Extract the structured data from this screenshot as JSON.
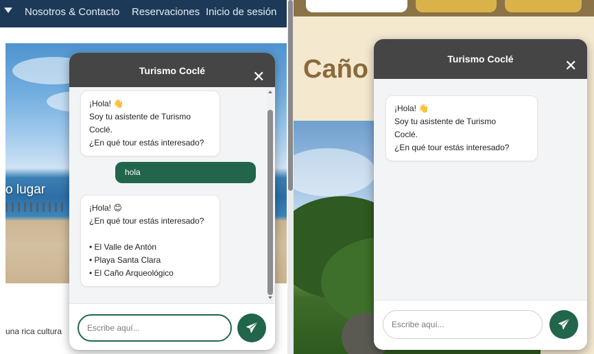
{
  "left_page": {
    "nav_items": [
      "Nosotros & Contacto",
      "Reservaciones",
      "Inicio de sesión"
    ],
    "hero_text": "o lugar",
    "footer_text": "una rica cultura"
  },
  "right_page": {
    "heading": "Caño"
  },
  "chat_left": {
    "title": "Turismo Coclé",
    "close_symbol": "✕",
    "messages": [
      {
        "sender": "bot",
        "text": "¡Hola! 👋\nSoy tu asistente de Turismo\nCoclé.\n¿En qué tour estás interesado?"
      },
      {
        "sender": "user",
        "text": "hola"
      },
      {
        "sender": "bot",
        "text": "¡Hola! 😊\n¿En qué tour estás interesado?\n\n• El Valle de Antón\n• Playa Santa Clara\n• El Caño Arqueológico"
      }
    ],
    "input_value": "",
    "input_placeholder": "Escribe aquí...",
    "send_icon": "paper-plane-icon"
  },
  "chat_right": {
    "title": "Turismo Coclé",
    "close_symbol": "✕",
    "messages": [
      {
        "sender": "bot",
        "text": "¡Hola! 👋\nSoy tu asistente de Turismo\nCoclé.\n¿En qué tour estás interesado?"
      }
    ],
    "input_value": "",
    "input_placeholder": "Escribe aquí...",
    "send_icon": "paper-plane-icon"
  },
  "colors": {
    "chat_header": "#454545",
    "accent_green": "#21654b",
    "left_nav": "#1c3a57",
    "right_topbar": "#8b7247",
    "right_heading": "#8a6a3c"
  }
}
